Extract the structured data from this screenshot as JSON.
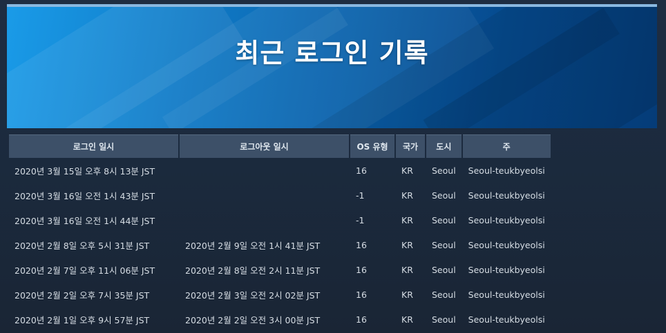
{
  "page": {
    "title": "최근 로그인 기록"
  },
  "table": {
    "headers": {
      "login": "로그인 일시",
      "logout": "로그아웃 일시",
      "os": "OS 유형",
      "country": "국가",
      "city": "도시",
      "state": "주"
    },
    "rows": [
      {
        "login": "2020년 3월 15일 오후 8시 13분 JST",
        "logout": "",
        "os": "16",
        "country": "KR",
        "city": "Seoul",
        "state": "Seoul-teukbyeolsi"
      },
      {
        "login": "2020년 3월 16일 오전 1시 43분 JST",
        "logout": "",
        "os": "-1",
        "country": "KR",
        "city": "Seoul",
        "state": "Seoul-teukbyeolsi"
      },
      {
        "login": "2020년 3월 16일 오전 1시 44분 JST",
        "logout": "",
        "os": "-1",
        "country": "KR",
        "city": "Seoul",
        "state": "Seoul-teukbyeolsi"
      },
      {
        "login": "2020년 2월 8일 오후 5시 31분 JST",
        "logout": "2020년 2월 9일 오전 1시 41분 JST",
        "os": "16",
        "country": "KR",
        "city": "Seoul",
        "state": "Seoul-teukbyeolsi"
      },
      {
        "login": "2020년 2월 7일 오후 11시 06분 JST",
        "logout": "2020년 2월 8일 오전 2시 11분 JST",
        "os": "16",
        "country": "KR",
        "city": "Seoul",
        "state": "Seoul-teukbyeolsi"
      },
      {
        "login": "2020년 2월 2일 오후 7시 35분 JST",
        "logout": "2020년 2월 3일 오전 2시 02분 JST",
        "os": "16",
        "country": "KR",
        "city": "Seoul",
        "state": "Seoul-teukbyeolsi"
      },
      {
        "login": "2020년 2월 1일 오후 9시 57분 JST",
        "logout": "2020년 2월 2일 오전 3시 00분 JST",
        "os": "16",
        "country": "KR",
        "city": "Seoul",
        "state": "Seoul-teukbyeolsi"
      }
    ]
  },
  "colors": {
    "banner_light": "#1a9be8",
    "banner_dark": "#053c78",
    "header_bg": "#3d5068",
    "page_bg": "#1b2a3d"
  }
}
